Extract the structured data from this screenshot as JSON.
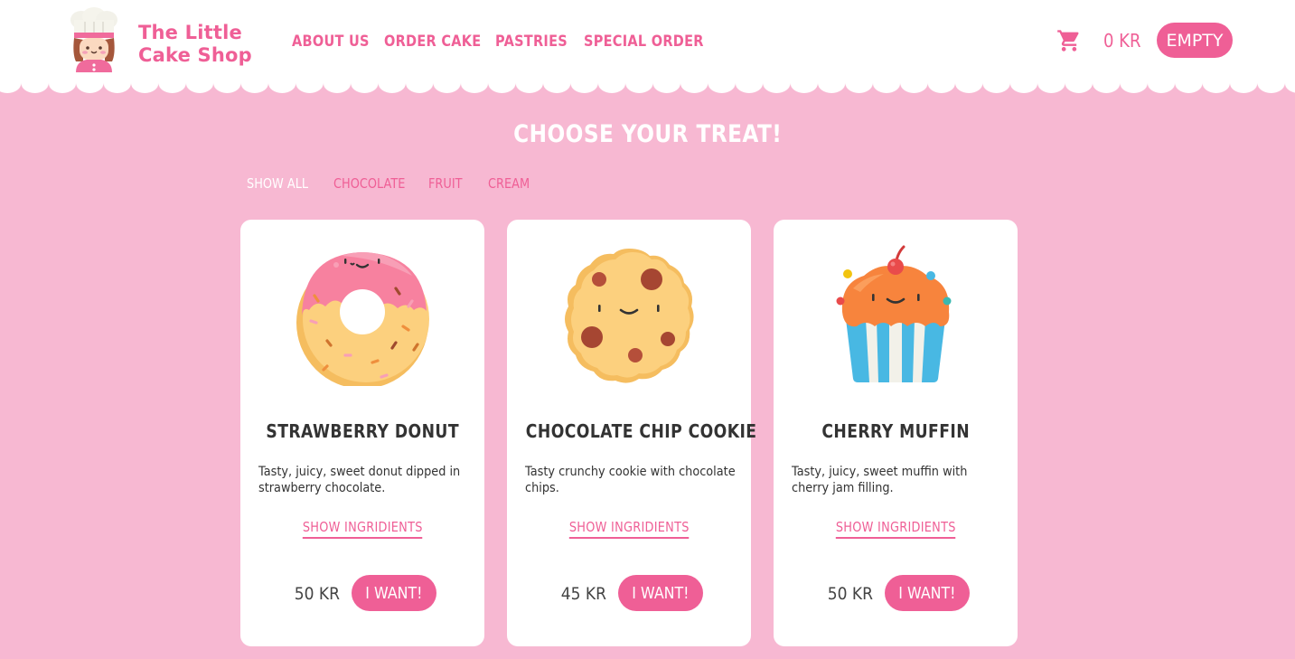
{
  "brand": {
    "name": "The Little Cake Shop",
    "line1": "The Little",
    "line2": "Cake Shop"
  },
  "nav": [
    "ABOUT US",
    "ORDER CAKE",
    "PASTRIES",
    "SPECIAL ORDER"
  ],
  "cart": {
    "total": "0 KR",
    "empty_label": "EMPTY",
    "icon": "cart-icon"
  },
  "main": {
    "title": "CHOOSE YOUR TREAT!",
    "filters": [
      "SHOW ALL",
      "CHOCOLATE",
      "FRUIT",
      "CREAM"
    ],
    "active_filter": "SHOW ALL"
  },
  "products": [
    {
      "name": "STRAWBERRY DONUT",
      "description": "Tasty, juicy, sweet donut dipped in strawberry chocolate.",
      "ingredients_link": "SHOW INGRIDIENTS",
      "price": "50 KR",
      "button": "I WANT!",
      "icon": "donut-icon"
    },
    {
      "name": "CHOCOLATE CHIP COOKIE",
      "description": "Tasty crunchy cookie with chocolate chips.",
      "ingredients_link": "SHOW INGRIDIENTS",
      "price": "45 KR",
      "button": "I WANT!",
      "icon": "cookie-icon"
    },
    {
      "name": "CHERRY MUFFIN",
      "description": "Tasty, juicy, sweet muffin with cherry jam filling.",
      "ingredients_link": "SHOW INGRIDIENTS",
      "price": "50 KR",
      "button": "I WANT!",
      "icon": "muffin-icon"
    }
  ],
  "colors": {
    "accent": "#ef5f96",
    "background": "#f7b8d2",
    "card": "#ffffff",
    "text": "#333333"
  }
}
